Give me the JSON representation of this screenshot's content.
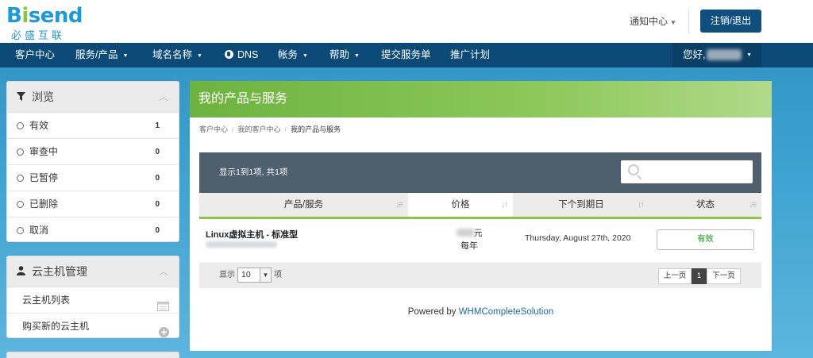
{
  "brand": {
    "logo_main": "Bisend",
    "logo_sub": "必盛互联"
  },
  "header": {
    "notify_label": "通知中心",
    "logout_label": "注销/退出"
  },
  "nav": {
    "items": [
      {
        "label": "客户中心",
        "dropdown": false
      },
      {
        "label": "服务/产品",
        "dropdown": true
      },
      {
        "label": "域名名称",
        "dropdown": true
      },
      {
        "label": "DNS",
        "dropdown": false,
        "icon": "globe-icon"
      },
      {
        "label": "帐务",
        "dropdown": true
      },
      {
        "label": "帮助",
        "dropdown": true
      },
      {
        "label": "提交服务单",
        "dropdown": false
      },
      {
        "label": "推广计划",
        "dropdown": false
      }
    ],
    "greeting": "您好,"
  },
  "sidebar": {
    "browse": {
      "title": "浏览",
      "icon": "filter-icon",
      "items": [
        {
          "label": "有效",
          "count": "1"
        },
        {
          "label": "审查中",
          "count": "0"
        },
        {
          "label": "已暂停",
          "count": "0"
        },
        {
          "label": "已删除",
          "count": "0"
        },
        {
          "label": "取消",
          "count": "0"
        }
      ]
    },
    "cloud": {
      "title": "云主机管理",
      "icon": "user-icon",
      "items": [
        {
          "label": "云主机列表",
          "icon": "list-icon"
        },
        {
          "label": "购买新的云主机",
          "icon": "plus-circle-icon"
        }
      ]
    }
  },
  "main": {
    "title": "我的产品与服务",
    "breadcrumb": [
      "客户中心",
      "我的客户中心",
      "我的产品与服务"
    ],
    "table_info": "显示1到1项, 共1项",
    "search": {
      "placeholder": ""
    },
    "columns": [
      "产品/服务",
      "价格",
      "下个到期日",
      "状态"
    ],
    "rows": [
      {
        "product": "Linux虚拟主机 - 标准型",
        "price_unit": "元",
        "cycle": "每年",
        "due": "Thursday, August 27th, 2020",
        "status": "有效"
      }
    ],
    "show_label": "显示",
    "page_size": "10",
    "show_suffix": "项",
    "pager": {
      "prev": "上一页",
      "current": "1",
      "next": "下一页"
    },
    "powered_prefix": "Powered by ",
    "powered_link": "WHMCompleteSolution"
  },
  "colors": {
    "accent_green": "#8cc63f",
    "nav_bg": "#0b4a77",
    "table_bar": "#4e5f6e",
    "status_active": "#5cb85c"
  }
}
